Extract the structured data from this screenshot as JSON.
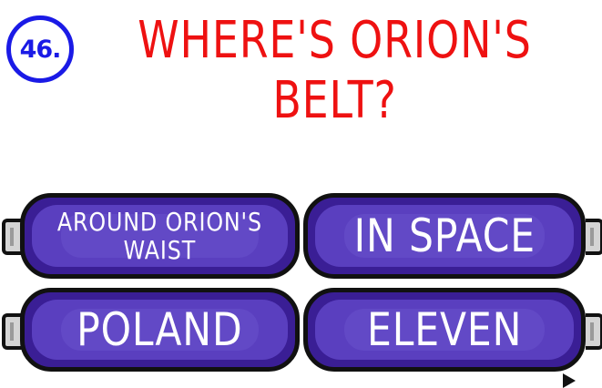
{
  "level": {
    "number": "46."
  },
  "question": {
    "line1": "WHERE'S ORION'S",
    "line2": "BELT?"
  },
  "answers": [
    {
      "label": "AROUND ORION'S\nWAIST"
    },
    {
      "label": "IN SPACE"
    },
    {
      "label": "POLAND"
    },
    {
      "label": "ELEVEN"
    }
  ],
  "colors": {
    "question_text": "#ee1111",
    "level_badge": "#1a1ae6",
    "button_fill": "#3a1e95",
    "button_inner": "#5a3fbf",
    "button_border": "#111111",
    "button_text": "#ffffff"
  }
}
